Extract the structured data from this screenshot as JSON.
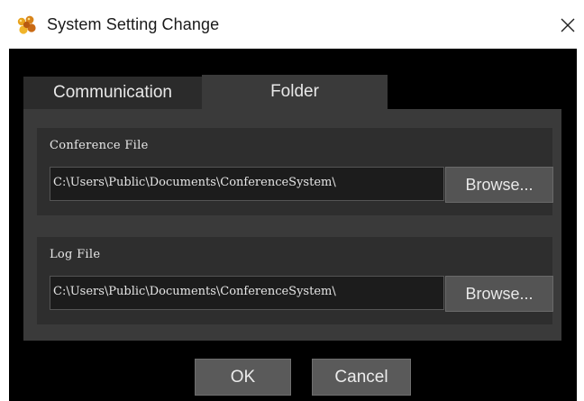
{
  "window": {
    "title": "System Setting Change",
    "app_icon": "cluster-icon",
    "close_icon": "close-icon"
  },
  "tabs": [
    {
      "label": "Communication",
      "active": false
    },
    {
      "label": "Folder",
      "active": true
    }
  ],
  "folder": {
    "conference": {
      "label": "Conference File",
      "path": "C:\\Users\\Public\\Documents\\ConferenceSystem\\",
      "browse_label": "Browse..."
    },
    "log": {
      "label": "Log File",
      "path": "C:\\Users\\Public\\Documents\\ConferenceSystem\\",
      "browse_label": "Browse..."
    }
  },
  "buttons": {
    "ok_label": "OK",
    "cancel_label": "Cancel"
  },
  "colors": {
    "client_bg": "#000000",
    "panel_bg": "#3a3a3a",
    "group_bg": "#2e2e2e",
    "button_bg": "#545454",
    "text": "#e8e8e8"
  }
}
